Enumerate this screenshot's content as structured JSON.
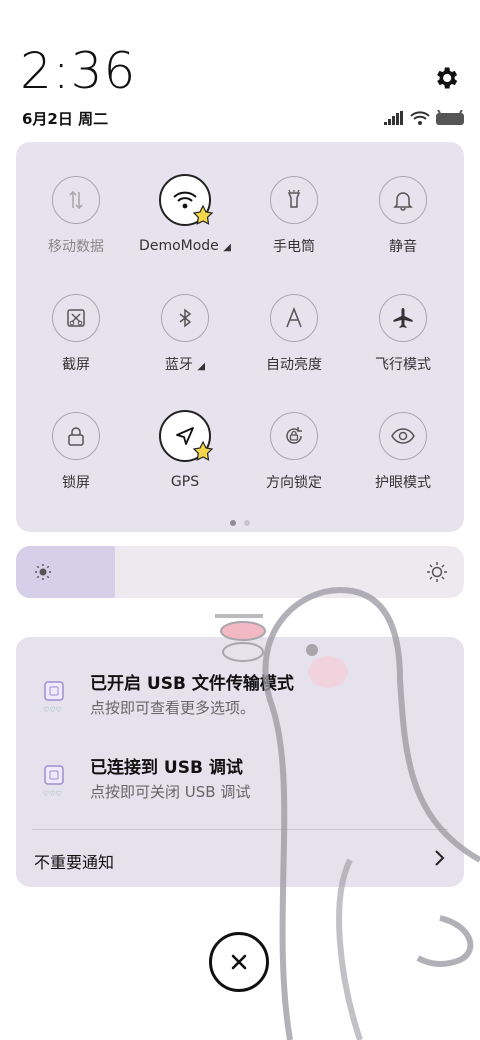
{
  "status": {
    "time": "2:36",
    "date": "6月2日 周二"
  },
  "quick_settings": {
    "tiles": [
      {
        "label": "移动数据",
        "icon": "mobile-data-icon",
        "active": false
      },
      {
        "label": "DemoMode",
        "icon": "wifi-icon",
        "active": true,
        "has_menu": true
      },
      {
        "label": "手电筒",
        "icon": "flashlight-icon",
        "active": false
      },
      {
        "label": "静音",
        "icon": "bell-icon",
        "active": false
      },
      {
        "label": "截屏",
        "icon": "screenshot-icon",
        "active": false
      },
      {
        "label": "蓝牙",
        "icon": "bluetooth-icon",
        "active": false,
        "has_menu": true
      },
      {
        "label": "自动亮度",
        "icon": "auto-brightness-icon",
        "active": false
      },
      {
        "label": "飞行模式",
        "icon": "airplane-icon",
        "active": false
      },
      {
        "label": "锁屏",
        "icon": "lock-icon",
        "active": false
      },
      {
        "label": "GPS",
        "icon": "location-arrow-icon",
        "active": true
      },
      {
        "label": "方向锁定",
        "icon": "rotation-lock-icon",
        "active": false
      },
      {
        "label": "护眼模式",
        "icon": "eye-icon",
        "active": false
      }
    ],
    "page_count": 2,
    "current_page": 1
  },
  "brightness": {
    "level": 0.22
  },
  "notifications": [
    {
      "title": "已开启 USB 文件传输模式",
      "body": "点按即可查看更多选项。"
    },
    {
      "title": "已连接到 USB 调试",
      "body": "点按即可关闭 USB 调试"
    }
  ],
  "unimportant_label": "不重要通知",
  "colors": {
    "panel": "#e6e2ee",
    "brightness_fill": "#d6cfe9",
    "star": "#f5d54a"
  }
}
